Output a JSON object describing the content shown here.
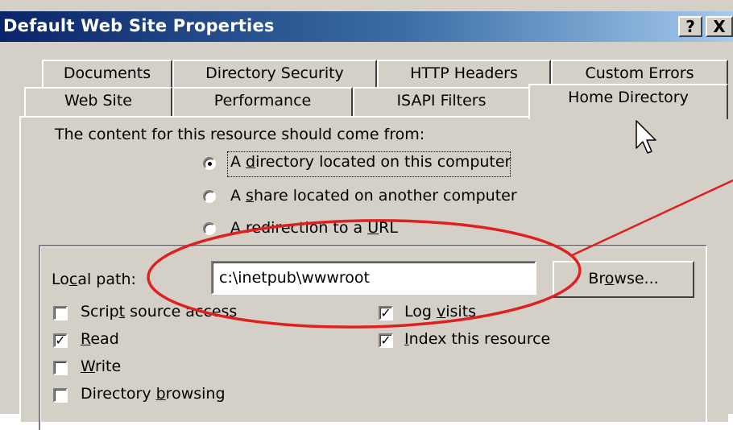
{
  "window": {
    "title": "Default Web Site Properties",
    "help_button": "?",
    "close_button": "X"
  },
  "tabs": {
    "row1": [
      "Documents",
      "Directory Security",
      "HTTP Headers",
      "Custom Errors"
    ],
    "row2": [
      "Web Site",
      "Performance",
      "ISAPI Filters",
      "Home Directory"
    ],
    "active": "Home Directory"
  },
  "content_source": {
    "heading": "The content for this resource should come from:",
    "options": [
      {
        "pre": "A ",
        "u": "d",
        "post": "irectory located on this computer",
        "selected": true
      },
      {
        "pre": "A ",
        "u": "s",
        "post": "hare located on another computer",
        "selected": false
      },
      {
        "pre": "A redirection to a ",
        "u": "U",
        "post": "RL",
        "selected": false
      }
    ]
  },
  "local_path": {
    "label_pre": "Lo",
    "label_u": "c",
    "label_post": "al path:",
    "value": "c:\\inetpub\\wwwroot",
    "browse_pre": "Br",
    "browse_u": "o",
    "browse_post": "wse..."
  },
  "permissions": [
    {
      "pre": "Scrip",
      "u": "t",
      "post": " source access",
      "checked": false
    },
    {
      "pre": "",
      "u": "R",
      "post": "ead",
      "checked": true
    },
    {
      "pre": "",
      "u": "W",
      "post": "rite",
      "checked": false
    },
    {
      "pre": "Directory ",
      "u": "b",
      "post": "rowsing",
      "checked": false
    },
    {
      "pre": "Log ",
      "u": "v",
      "post": "isits",
      "checked": true
    },
    {
      "pre": "",
      "u": "I",
      "post": "ndex this resource",
      "checked": true
    }
  ],
  "check_mark": "✓",
  "annotation_color": "#e02020"
}
